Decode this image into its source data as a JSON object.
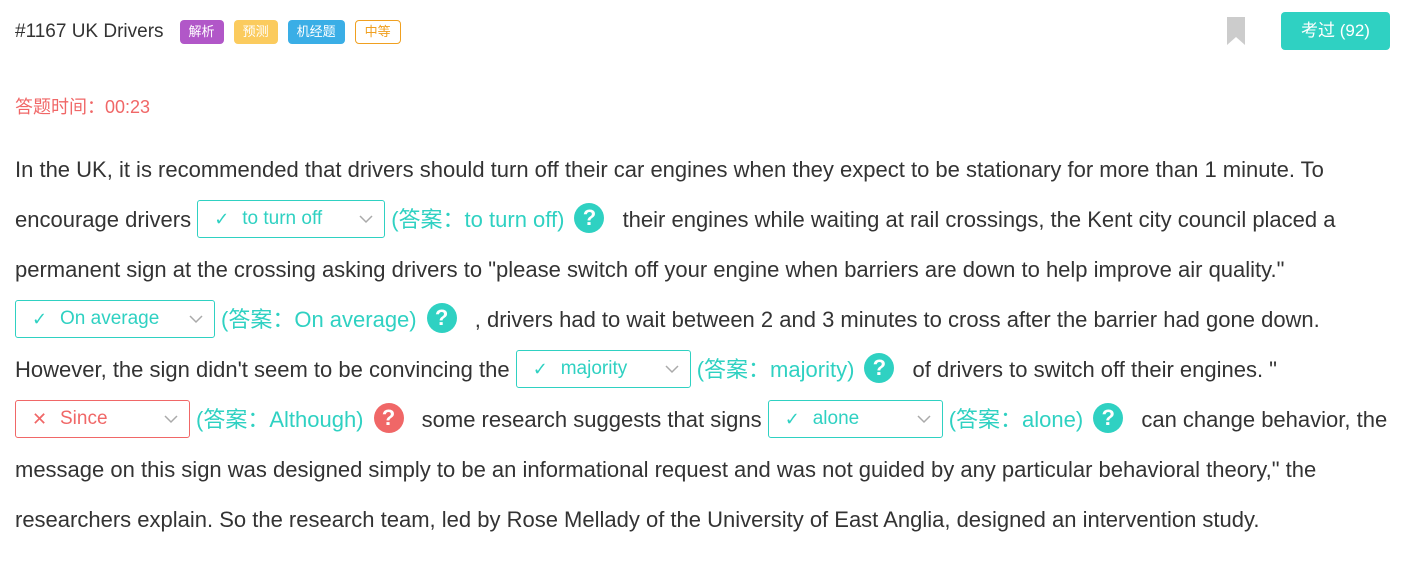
{
  "header": {
    "title": "#1167 UK Drivers",
    "tags": [
      "解析",
      "预测",
      "机经题",
      "中等"
    ],
    "passed_button": "考过 (92)"
  },
  "timer": {
    "label": "答题时间：",
    "value": "00:23"
  },
  "passage": {
    "t1": "In the UK, it is recommended that drivers should turn off their car engines when they expect to be stationary for more than 1 minute. To encourage drivers",
    "t2": "their engines while waiting at rail crossings, the Kent city council placed a permanent sign at the crossing asking drivers to \"please switch off your engine when barriers are down to help improve air quality.\"",
    "t3": ", drivers had to wait between 2 and 3 minutes to cross after the barrier had gone down. However, the sign didn't seem to be convincing the",
    "t4": "of drivers to switch off their engines. \"",
    "t5": "some research suggests that signs",
    "t6": "can change behavior, the message on this sign was designed simply to be an informational request and was not guided by any particular behavioral theory,\" the researchers explain. So the research team, led by Rose Mellady of the University of East Anglia, designed an intervention study."
  },
  "blanks": [
    {
      "selected": "to turn off",
      "answer": "(答案：to turn off)",
      "correct": true,
      "mark": "✓"
    },
    {
      "selected": "On average",
      "answer": "(答案：On average)",
      "correct": true,
      "mark": "✓"
    },
    {
      "selected": "majority",
      "answer": "(答案：majority)",
      "correct": true,
      "mark": "✓"
    },
    {
      "selected": "Since",
      "answer": "(答案：Although)",
      "correct": false,
      "mark": "✕"
    },
    {
      "selected": "alone",
      "answer": "(答案：alone)",
      "correct": true,
      "mark": "✓"
    }
  ],
  "help_symbol": "?",
  "colors": {
    "accent": "#2fd1c2",
    "error": "#f06767",
    "tag_jiexi": "#b157c8",
    "tag_yuce": "#fbcb5e",
    "tag_jijing": "#3aaee6",
    "tag_level": "#f0a020"
  },
  "icons": {
    "bookmark": "bookmark-icon",
    "dropdown": "chevron-down-icon",
    "correct": "check-icon",
    "wrong": "cross-icon",
    "help": "question-icon"
  }
}
